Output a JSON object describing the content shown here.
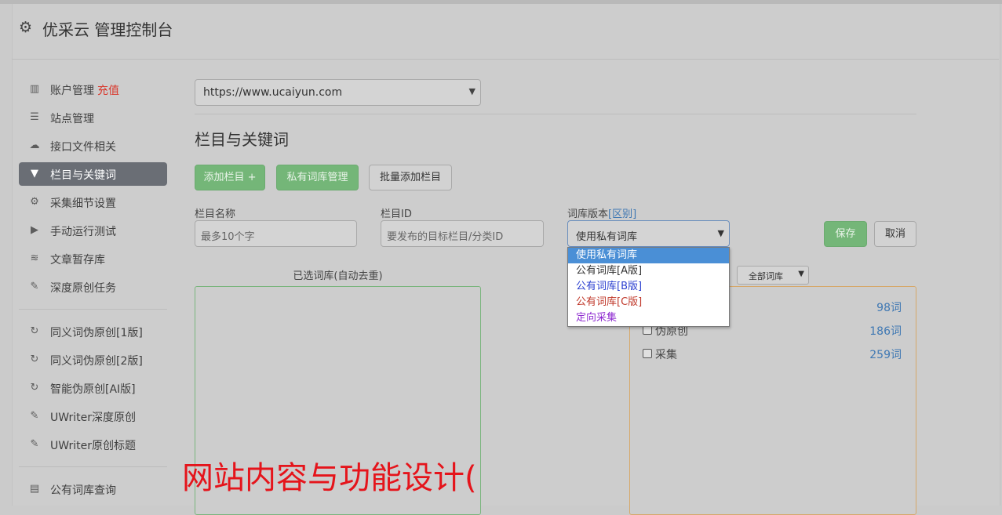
{
  "app": {
    "title": "优采云 管理控制台"
  },
  "sidebar": {
    "recharge_label": "充值",
    "items": [
      {
        "label": "账户管理",
        "icon": "bar-chart-icon"
      },
      {
        "label": "站点管理",
        "icon": "server-icon"
      },
      {
        "label": "接口文件相关",
        "icon": "cloud-upload-icon"
      },
      {
        "label": "栏目与关键词",
        "icon": "filter-icon",
        "active": true
      },
      {
        "label": "采集细节设置",
        "icon": "gears-icon"
      },
      {
        "label": "手动运行测试",
        "icon": "play-circle-icon"
      },
      {
        "label": "文章暂存库",
        "icon": "database-icon"
      },
      {
        "label": "深度原创任务",
        "icon": "edit-icon"
      },
      {
        "label": "同义词伪原创[1版]",
        "icon": "refresh-icon"
      },
      {
        "label": "同义词伪原创[2版]",
        "icon": "refresh-icon"
      },
      {
        "label": "智能伪原创[AI版]",
        "icon": "refresh-icon"
      },
      {
        "label": "UWriter深度原创",
        "icon": "edit-icon"
      },
      {
        "label": "UWriter原创标题",
        "icon": "edit-icon"
      },
      {
        "label": "公有词库查询",
        "icon": "book-icon"
      }
    ]
  },
  "main": {
    "site_select": {
      "value": "https://www.ucaiyun.com"
    },
    "section_title": "栏目与关键词",
    "buttons": {
      "add_column": "添加栏目 +",
      "private_lib": "私有词库管理",
      "batch_add": "批量添加栏目"
    },
    "form": {
      "name_label": "栏目名称",
      "name_placeholder": "最多10个字",
      "id_label": "栏目ID",
      "id_placeholder": "要发布的目标栏目/分类ID",
      "version_label": "词库版本",
      "version_link": "[区别]",
      "version_value": "使用私有词库",
      "save": "保存",
      "cancel": "取消"
    },
    "version_options": [
      {
        "label": "使用私有词库",
        "color": "#ffffff",
        "selected": true
      },
      {
        "label": "公有词库[A版]",
        "color": "#333333"
      },
      {
        "label": "公有词库[B版]",
        "color": "#2b3fd0"
      },
      {
        "label": "公有词库[C版]",
        "color": "#c0392b"
      },
      {
        "label": "定向采集",
        "color": "#8e2bd0"
      }
    ],
    "selected_libs_title": "已选词库(自动去重)",
    "all_libs_select": "全部词库",
    "libraries": [
      {
        "name": "",
        "count": "98词"
      },
      {
        "name": "伪原创",
        "count": "186词"
      },
      {
        "name": "采集",
        "count": "259词"
      }
    ]
  },
  "watermark": "网站内容与功能设计("
}
